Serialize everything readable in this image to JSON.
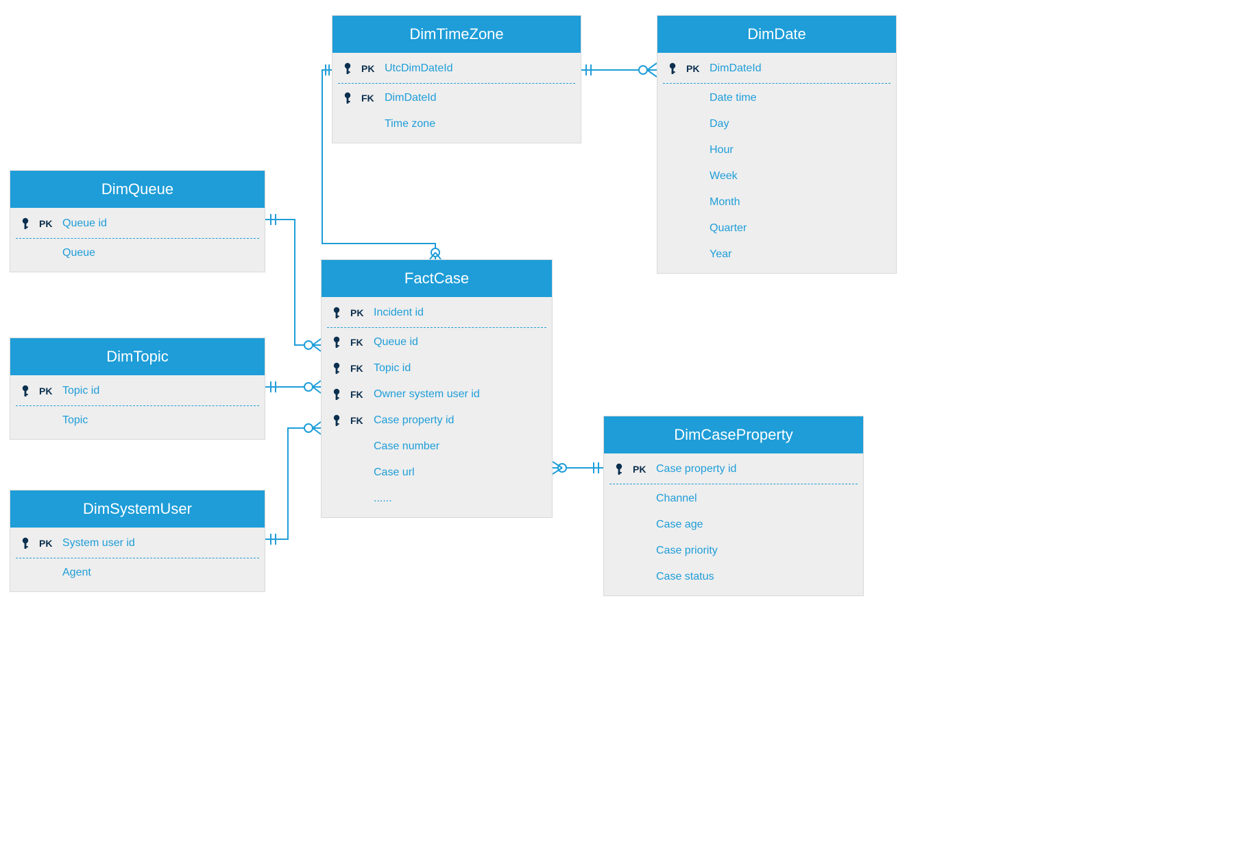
{
  "colors": {
    "brand": "#1e9dd8",
    "dark": "#0b2f4e",
    "panel": "#eeeeee"
  },
  "tables": {
    "dimTimeZone": {
      "title": "DimTimeZone",
      "rows": [
        {
          "keytype": "PK",
          "name": "UtcDimDateId"
        },
        {
          "keytype": "FK",
          "name": "DimDateId"
        },
        {
          "keytype": "",
          "name": "Time zone"
        }
      ]
    },
    "dimDate": {
      "title": "DimDate",
      "rows": [
        {
          "keytype": "PK",
          "name": "DimDateId"
        },
        {
          "keytype": "",
          "name": "Date time"
        },
        {
          "keytype": "",
          "name": "Day"
        },
        {
          "keytype": "",
          "name": "Hour"
        },
        {
          "keytype": "",
          "name": "Week"
        },
        {
          "keytype": "",
          "name": "Month"
        },
        {
          "keytype": "",
          "name": "Quarter"
        },
        {
          "keytype": "",
          "name": "Year"
        }
      ]
    },
    "dimQueue": {
      "title": "DimQueue",
      "rows": [
        {
          "keytype": "PK",
          "name": "Queue id"
        },
        {
          "keytype": "",
          "name": "Queue"
        }
      ]
    },
    "dimTopic": {
      "title": "DimTopic",
      "rows": [
        {
          "keytype": "PK",
          "name": "Topic id"
        },
        {
          "keytype": "",
          "name": "Topic"
        }
      ]
    },
    "dimSystemUser": {
      "title": "DimSystemUser",
      "rows": [
        {
          "keytype": "PK",
          "name": "System user id"
        },
        {
          "keytype": "",
          "name": "Agent"
        }
      ]
    },
    "factCase": {
      "title": "FactCase",
      "rows": [
        {
          "keytype": "PK",
          "name": "Incident id"
        },
        {
          "keytype": "FK",
          "name": "Queue id"
        },
        {
          "keytype": "FK",
          "name": "Topic id"
        },
        {
          "keytype": "FK",
          "name": "Owner system user id"
        },
        {
          "keytype": "FK",
          "name": "Case property id"
        },
        {
          "keytype": "",
          "name": "Case number"
        },
        {
          "keytype": "",
          "name": "Case url"
        },
        {
          "keytype": "",
          "name": "......"
        }
      ]
    },
    "dimCaseProperty": {
      "title": "DimCaseProperty",
      "rows": [
        {
          "keytype": "PK",
          "name": "Case property id"
        },
        {
          "keytype": "",
          "name": "Channel"
        },
        {
          "keytype": "",
          "name": "Case age"
        },
        {
          "keytype": "",
          "name": "Case priority"
        },
        {
          "keytype": "",
          "name": "Case status"
        }
      ]
    }
  },
  "relationships": [
    {
      "from": "FactCase.Queue id",
      "to": "DimQueue.Queue id",
      "type": "many-to-one"
    },
    {
      "from": "FactCase.Topic id",
      "to": "DimTopic.Topic id",
      "type": "many-to-one"
    },
    {
      "from": "FactCase.Owner system user id",
      "to": "DimSystemUser.System user id",
      "type": "many-to-one"
    },
    {
      "from": "FactCase.Case property id",
      "to": "DimCaseProperty.Case property id",
      "type": "many-to-one"
    },
    {
      "from": "FactCase.UtcDimDateId-join",
      "to": "DimTimeZone.UtcDimDateId",
      "type": "many-to-one"
    },
    {
      "from": "DimTimeZone.DimDateId",
      "to": "DimDate.DimDateId",
      "type": "many-to-one"
    }
  ]
}
